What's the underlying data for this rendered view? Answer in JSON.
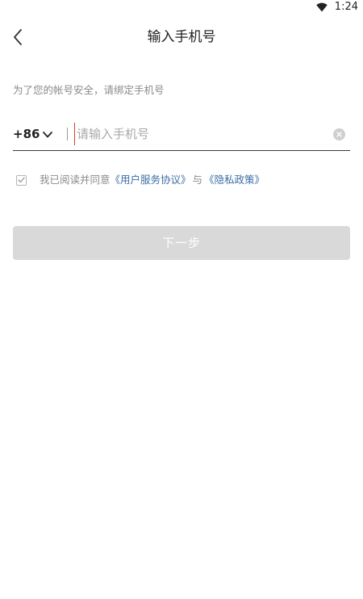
{
  "status_bar": {
    "time": "1:24",
    "wifi_icon": "wifi-icon"
  },
  "header": {
    "back_icon": "chevron-left-icon",
    "title": "输入手机号"
  },
  "hint": "为了您的帐号安全，请绑定手机号",
  "phone": {
    "country_code": "+86",
    "placeholder": "请输入手机号",
    "value": "",
    "clear_icon": "clear-icon"
  },
  "agreement": {
    "checked": true,
    "prefix": "我已阅读并同意",
    "user_agreement_link": "《用户服务协议》",
    "conjunction": "与",
    "privacy_link": "《隐私政策》"
  },
  "next_button": {
    "label": "下一步",
    "enabled": false
  },
  "colors": {
    "link": "#3a6ea5",
    "button_disabled": "#d9d9d9",
    "cursor": "#d0413a"
  }
}
